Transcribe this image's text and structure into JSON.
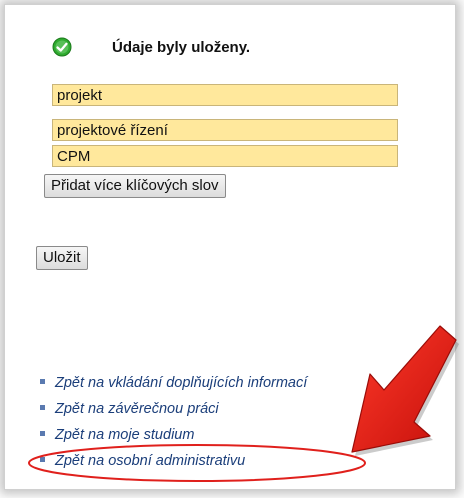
{
  "status": {
    "message": "Údaje byly uloženy.",
    "icon": "check-circle-icon"
  },
  "keywords": [
    "projekt",
    "projektové řízení",
    "CPM"
  ],
  "buttons": {
    "add_more": "Přidat více klíčových slov",
    "save": "Uložit"
  },
  "links": [
    "Zpět na vkládání doplňujících informací",
    "Zpět na závěrečnou práci",
    "Zpět na moje studium",
    "Zpět na osobní administrativu"
  ],
  "colors": {
    "keyword_bg": "#ffe89c",
    "link": "#1b3e7a",
    "annotation": "#e0201c",
    "success": "#2eaa2e"
  }
}
